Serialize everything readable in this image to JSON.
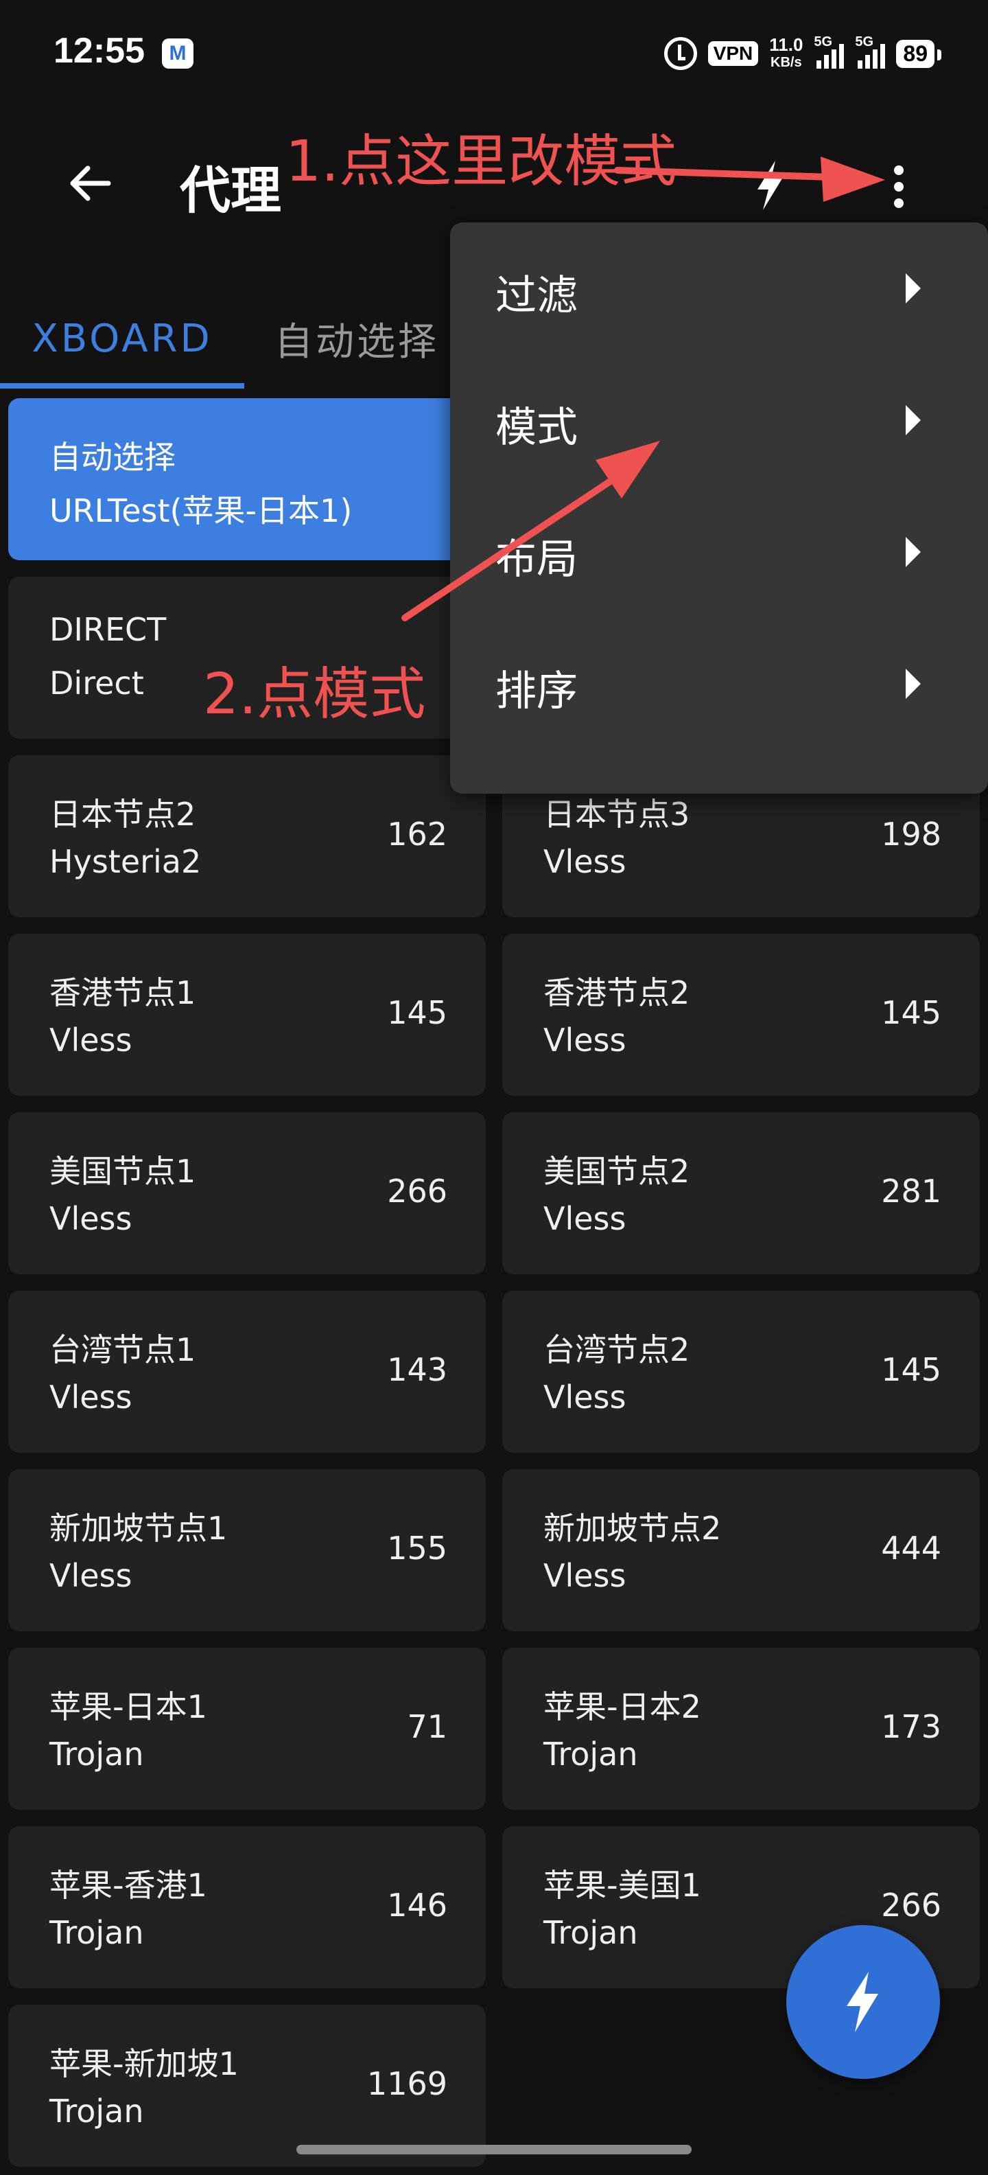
{
  "status_bar": {
    "time": "12:55",
    "app_icon_letter": "M",
    "vpn": "VPN",
    "speed_value": "11.0",
    "speed_unit": "KB/s",
    "sim1": "5G",
    "sim2": "5G",
    "battery": "89"
  },
  "app_bar": {
    "title": "代理"
  },
  "tabs": [
    {
      "label": "XBOARD",
      "active": true
    },
    {
      "label": "自动选择",
      "active": false
    }
  ],
  "proxies": [
    {
      "name": "自动选择",
      "protocol": "URLTest(苹果-日本1)",
      "latency": "",
      "selected": true
    },
    {
      "name": "",
      "protocol": "",
      "latency": ""
    },
    {
      "name": "DIRECT",
      "protocol": "Direct",
      "latency": ""
    },
    {
      "name": "",
      "protocol": "",
      "latency": ""
    },
    {
      "name": "日本节点2",
      "protocol": "Hysteria2",
      "latency": "162"
    },
    {
      "name": "日本节点3",
      "protocol": "Vless",
      "latency": "198"
    },
    {
      "name": "香港节点1",
      "protocol": "Vless",
      "latency": "145"
    },
    {
      "name": "香港节点2",
      "protocol": "Vless",
      "latency": "145"
    },
    {
      "name": "美国节点1",
      "protocol": "Vless",
      "latency": "266"
    },
    {
      "name": "美国节点2",
      "protocol": "Vless",
      "latency": "281"
    },
    {
      "name": "台湾节点1",
      "protocol": "Vless",
      "latency": "143"
    },
    {
      "name": "台湾节点2",
      "protocol": "Vless",
      "latency": "145"
    },
    {
      "name": "新加坡节点1",
      "protocol": "Vless",
      "latency": "155"
    },
    {
      "name": "新加坡节点2",
      "protocol": "Vless",
      "latency": "444"
    },
    {
      "name": "苹果-日本1",
      "protocol": "Trojan",
      "latency": "71"
    },
    {
      "name": "苹果-日本2",
      "protocol": "Trojan",
      "latency": "173"
    },
    {
      "name": "苹果-香港1",
      "protocol": "Trojan",
      "latency": "146"
    },
    {
      "name": "苹果-美国1",
      "protocol": "Trojan",
      "latency": "266"
    },
    {
      "name": "苹果-新加坡1",
      "protocol": "Trojan",
      "latency": "1169"
    }
  ],
  "menu": {
    "items": [
      {
        "label": "过滤"
      },
      {
        "label": "模式"
      },
      {
        "label": "布局"
      },
      {
        "label": "排序"
      }
    ]
  },
  "annotations": {
    "step1": "1.点这里改模式",
    "step2": "2.点模式"
  },
  "colors": {
    "accent": "#3d7fe0",
    "annotation": "#f05252",
    "background": "#121212",
    "card": "#222222",
    "menu": "#363636"
  }
}
